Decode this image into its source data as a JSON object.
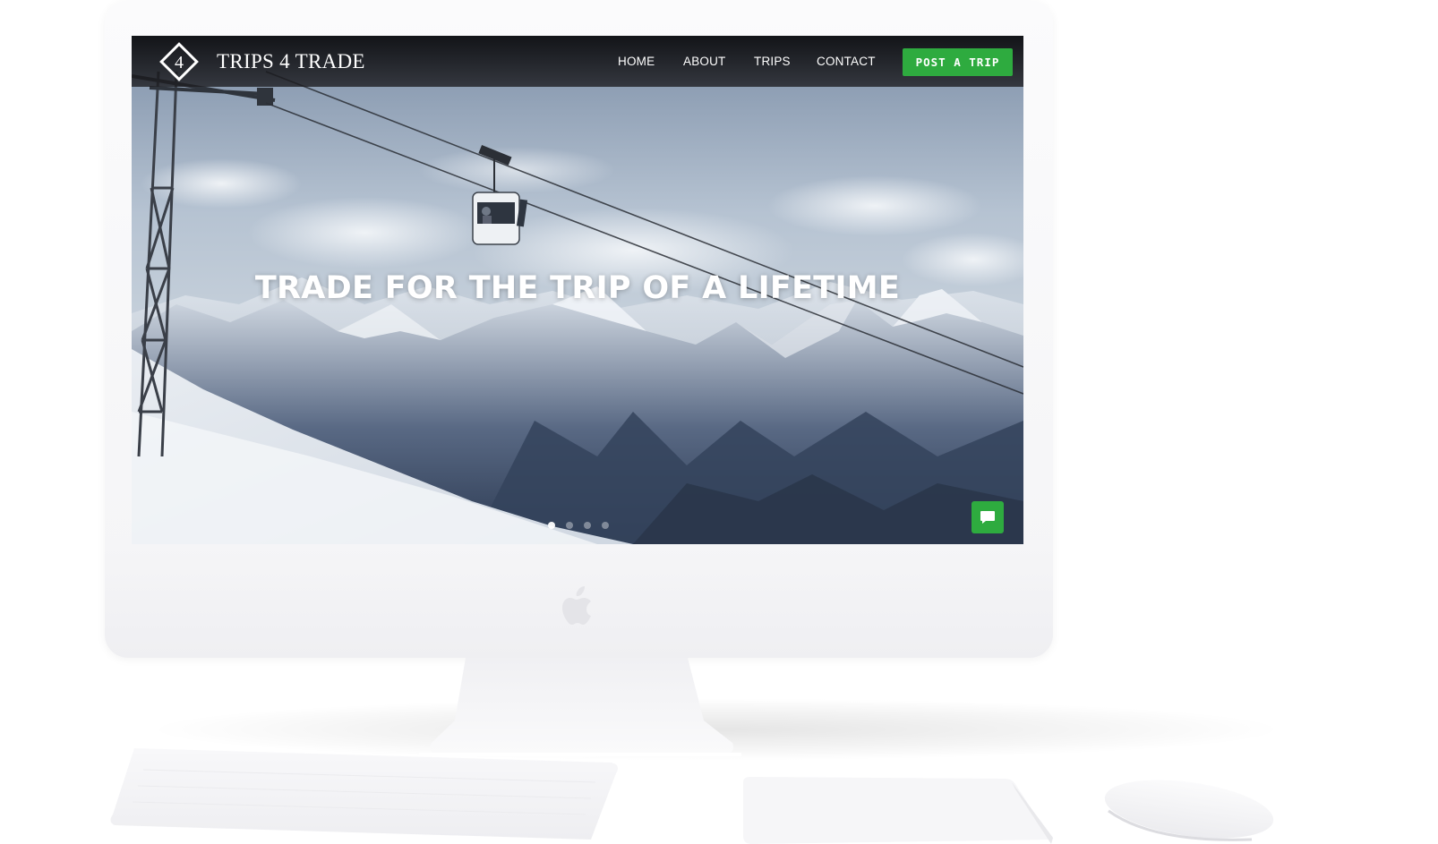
{
  "site": {
    "brand_name": "TRIPS 4 TRADE",
    "logo_icon": "diamond-4-logo-icon",
    "logo_mark_text": "4"
  },
  "nav": {
    "items": [
      {
        "label": "HOME"
      },
      {
        "label": "ABOUT"
      },
      {
        "label": "TRIPS"
      },
      {
        "label": "CONTACT"
      }
    ],
    "cta_label": "POST A TRIP"
  },
  "hero": {
    "heading": "TRADE FOR THE TRIP OF A LIFETIME",
    "slides": {
      "count": 4,
      "active_index": 0
    }
  },
  "chat": {
    "icon": "chat-bubble-icon"
  },
  "colors": {
    "accent_green": "#2eab3f",
    "nav_background": "#1a1a1c",
    "text_on_dark": "#ffffff",
    "device_white": "#f5f5f7"
  },
  "device": {
    "type": "iMac",
    "logo_icon": "apple-logo-icon",
    "peripherals": [
      "keyboard",
      "trackpad",
      "mouse"
    ]
  }
}
